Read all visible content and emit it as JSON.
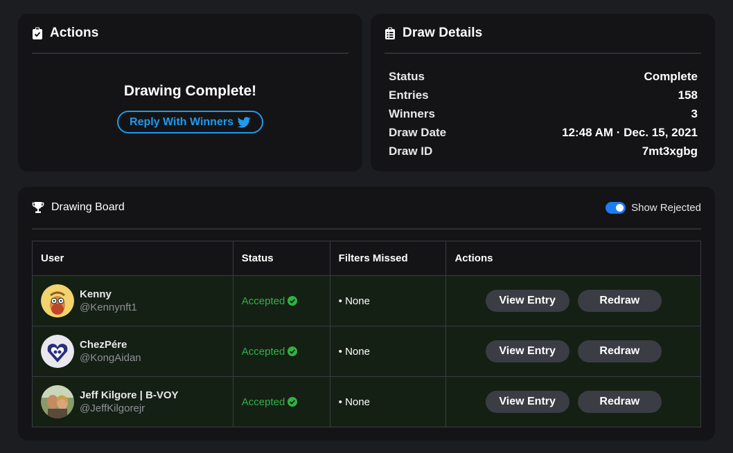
{
  "actions_card": {
    "title": "Actions",
    "message": "Drawing Complete!",
    "reply_button": "Reply With Winners"
  },
  "details_card": {
    "title": "Draw Details",
    "rows": [
      {
        "label": "Status",
        "value": "Complete"
      },
      {
        "label": "Entries",
        "value": "158"
      },
      {
        "label": "Winners",
        "value": "3"
      },
      {
        "label": "Draw Date",
        "value": "12:48 AM · Dec. 15, 2021"
      },
      {
        "label": "Draw ID",
        "value": "7mt3xgbg"
      }
    ]
  },
  "board": {
    "title": "Drawing Board",
    "toggle_label": "Show Rejected",
    "toggle_on": true,
    "columns": [
      "User",
      "Status",
      "Filters Missed",
      "Actions"
    ],
    "rows": [
      {
        "name": "Kenny",
        "handle": "@Kennynft1",
        "status": "Accepted",
        "filters": "• None",
        "view_label": "View Entry",
        "redraw_label": "Redraw"
      },
      {
        "name": "ChezPére",
        "handle": "@KongAidan",
        "status": "Accepted",
        "filters": "• None",
        "view_label": "View Entry",
        "redraw_label": "Redraw"
      },
      {
        "name": "Jeff Kilgore | B-VOY",
        "handle": "@JeffKilgorejr",
        "status": "Accepted",
        "filters": "• None",
        "view_label": "View Entry",
        "redraw_label": "Redraw"
      }
    ]
  },
  "colors": {
    "accent_blue": "#1d9bf0",
    "accepted_green": "#2fb344",
    "card_bg": "#141416",
    "page_bg": "#1c1d20"
  }
}
